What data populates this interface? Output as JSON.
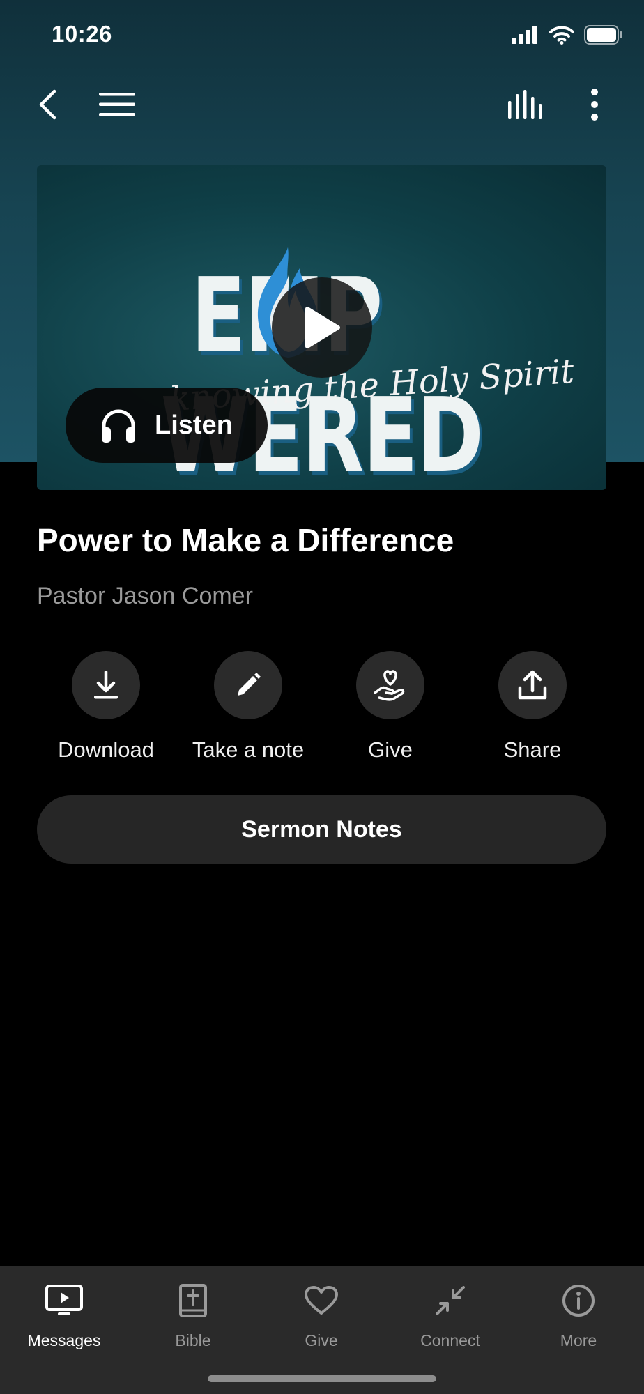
{
  "status_bar": {
    "time": "10:26"
  },
  "artwork": {
    "title_left": "EMP",
    "title_right": "WERED",
    "subtitle": "knowing the Holy Spirit"
  },
  "listen_button": {
    "label": "Listen",
    "icon": "headphones-icon"
  },
  "sermon": {
    "title": "Power to Make a Difference",
    "speaker": "Pastor Jason Comer"
  },
  "actions": [
    {
      "label": "Download",
      "icon": "download-icon"
    },
    {
      "label": "Take a note",
      "icon": "pencil-icon"
    },
    {
      "label": "Give",
      "icon": "heart-hand-icon"
    },
    {
      "label": "Share",
      "icon": "share-icon"
    }
  ],
  "sermon_notes_button": {
    "label": "Sermon Notes"
  },
  "tab_bar": {
    "tabs": [
      {
        "label": "Messages",
        "icon": "tv-play-icon",
        "active": true
      },
      {
        "label": "Bible",
        "icon": "bible-icon",
        "active": false
      },
      {
        "label": "Give",
        "icon": "heart-icon",
        "active": false
      },
      {
        "label": "Connect",
        "icon": "collapse-arrows-icon",
        "active": false
      },
      {
        "label": "More",
        "icon": "info-icon",
        "active": false
      }
    ]
  },
  "colors": {
    "hero_top": "#10303b",
    "hero_bottom": "#1d5364",
    "background": "#000000",
    "button_bg": "#262626",
    "tab_bar_bg": "#2a2a2a",
    "inactive_tab": "#9a9a9a"
  }
}
